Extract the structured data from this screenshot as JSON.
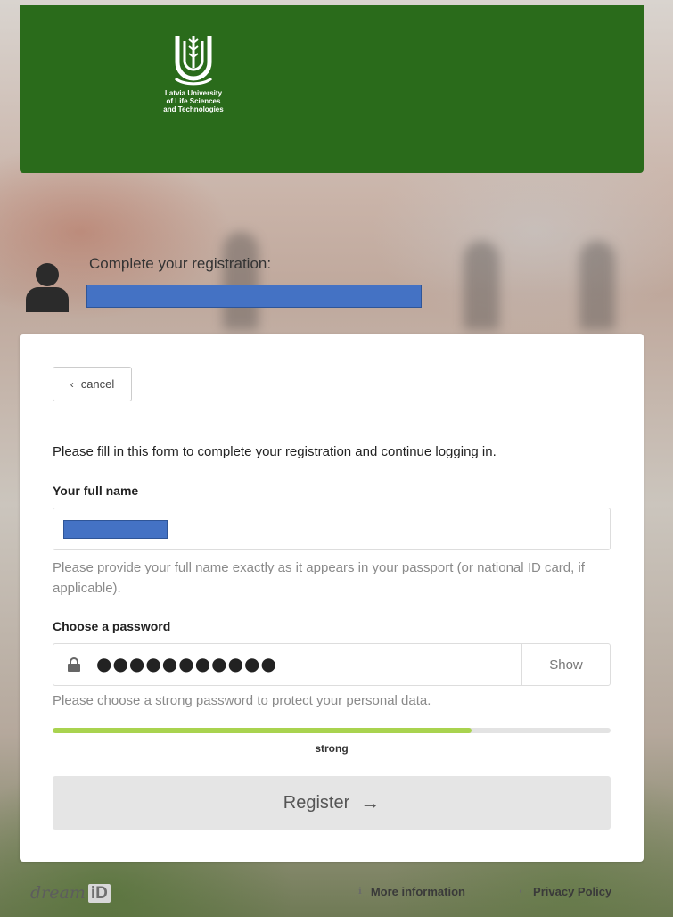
{
  "header": {
    "logo_lines": [
      "Latvia University",
      "of Life Sciences",
      "and Technologies"
    ]
  },
  "registration": {
    "title": "Complete your registration:"
  },
  "form": {
    "cancel_label": "cancel",
    "intro": "Please fill in this form to complete your registration and continue logging in.",
    "full_name_label": "Your full name",
    "full_name_help": "Please provide your full name exactly as it appears in your passport (or national ID card, if applicable).",
    "password_label": "Choose a password",
    "password_masked": "●●●●●●●●●●●",
    "show_label": "Show",
    "password_help": "Please choose a strong password to protect your personal data.",
    "strength_label": "strong",
    "strength_percent": 75,
    "register_label": "Register"
  },
  "footer": {
    "brand_word": "dream",
    "brand_id": "iD",
    "more_info_label": "More information",
    "privacy_label": "Privacy Policy"
  },
  "colors": {
    "header_green": "#2a6b1b",
    "strength_green": "#a9d34f",
    "redaction_blue": "#4472c4"
  }
}
